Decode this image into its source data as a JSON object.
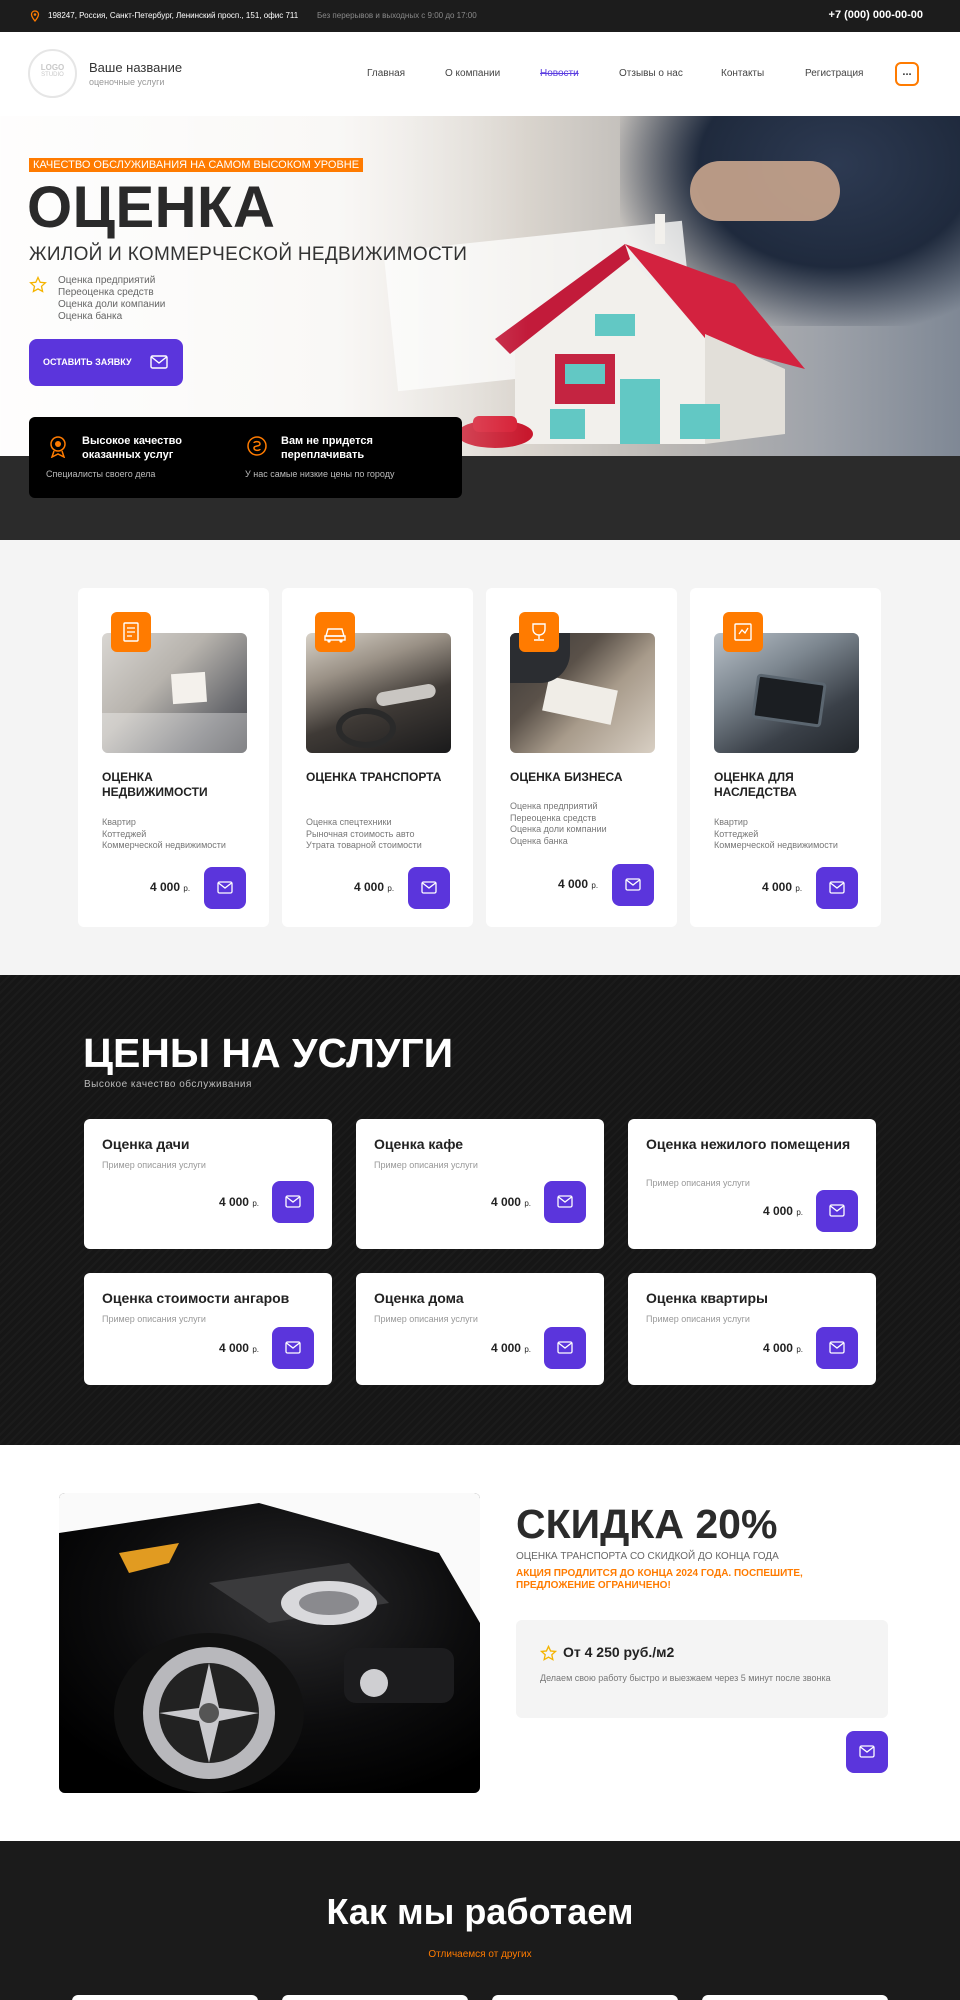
{
  "topbar": {
    "address": "198247, Россия, Санкт-Петербург, Ленинский просп., 151, офис 711",
    "hours": "Без перерывов и выходных с 9:00 до 17:00",
    "phone": "+7 (000) 000-00-00"
  },
  "header": {
    "logo_text": "LOGO",
    "logo_sub": "STUDIO",
    "brand_name": "Ваше название",
    "brand_sub": "оценочные услуги",
    "nav": [
      "Главная",
      "О компании",
      "Новости",
      "Отзывы о нас",
      "Контакты",
      "Регистрация"
    ],
    "active_nav": "Новости",
    "menu_label": "..."
  },
  "hero": {
    "tagline": "Качество обслуживания на самом высоком уровне",
    "title": "ОЦЕНКА",
    "subtitle": "ЖИЛОЙ И КОММЕРЧЕСКОЙ НЕДВИЖИМОСТИ",
    "list": [
      "Оценка предприятий",
      "Переоценка средств",
      "Оценка доли компании",
      "Оценка банка"
    ],
    "cta_label": "ОСТАВИТЬ ЗАЯВКУ",
    "features": [
      {
        "title": "Высокое качество оказанных услуг",
        "text": "Специалисты своего дела"
      },
      {
        "title": "Вам не придется переплачивать",
        "text": "У нас самые низкие цены по городу"
      }
    ]
  },
  "services": [
    {
      "title": "Оценка недвижимости",
      "items": [
        "Квартир",
        "Коттеджей",
        "Коммерческой недвижимости"
      ],
      "price": "4 000",
      "currency": "р."
    },
    {
      "title": "Оценка транспорта",
      "items": [
        "Оценка спецтехники",
        "Рыночная стоимость авто",
        "Утрата товарной стоимости"
      ],
      "price": "4 000",
      "currency": "р."
    },
    {
      "title": "Оценка бизнеса",
      "items": [
        "Оценка предприятий",
        "Переоценка средств",
        "Оценка доли компании",
        "Оценка банка"
      ],
      "price": "4 000",
      "currency": "р."
    },
    {
      "title": "Оценка для наследства",
      "items": [
        "Квартир",
        "Коттеджей",
        "Коммерческой недвижимости"
      ],
      "price": "4 000",
      "currency": "р."
    }
  ],
  "prices": {
    "title": "ЦЕНЫ НА УСЛУГИ",
    "subtitle": "Высокое  качество  обслуживания",
    "cards": [
      {
        "name": "Оценка дачи",
        "desc": "Пример описания услуги",
        "price": "4 000",
        "currency": "р."
      },
      {
        "name": "Оценка кафе",
        "desc": "Пример описания услуги",
        "price": "4 000",
        "currency": "р."
      },
      {
        "name": "Оценка нежилого помещения",
        "desc": "Пример описания услуги",
        "price": "4 000",
        "currency": "р."
      },
      {
        "name": "Оценка стоимости ангаров",
        "desc": "Пример описания услуги",
        "price": "4 000",
        "currency": "р."
      },
      {
        "name": "Оценка дома",
        "desc": "Пример описания услуги",
        "price": "4 000",
        "currency": "р."
      },
      {
        "name": "Оценка квартиры",
        "desc": "Пример описания услуги",
        "price": "4 000",
        "currency": "р."
      }
    ]
  },
  "discount": {
    "title": "СКИДКА 20%",
    "subtitle": "Оценка транспорта со скидкой до конца года",
    "notice": "Акция продлится до конца 2024 года. Поспешите, предложение ограничено!",
    "offer_title": "От 4 250 руб./м2",
    "offer_text": "Делаем свою работу быстро и выезжаем через 5 минут после звонка"
  },
  "how": {
    "title": "Как мы работаем",
    "subtitle": "Отличаемся от других"
  },
  "colors": {
    "accent": "#5b35dc",
    "orange": "#ff7b00",
    "dark": "#161616"
  },
  "icons": [
    "location-pin-icon",
    "star-icon",
    "mail-icon",
    "quality-icon",
    "savings-icon",
    "document-icon",
    "car-icon",
    "trophy-icon",
    "inheritance-icon",
    "menu-dots-icon"
  ]
}
